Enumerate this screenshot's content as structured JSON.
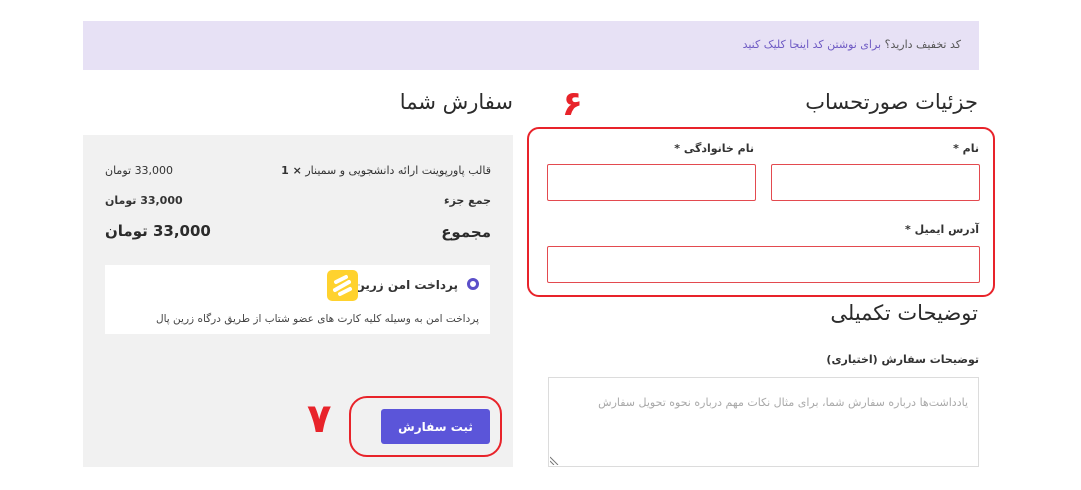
{
  "coupon": {
    "question": "کد تخفیف دارید؟",
    "link": "برای نوشتن کد اینجا کلیک کنید"
  },
  "billing": {
    "title": "جزئیات صورتحساب",
    "first_name_label": "نام",
    "last_name_label": "نام خانوادگی",
    "email_label": "آدرس ایمیل",
    "required_mark": "*"
  },
  "additional": {
    "title": "توضیحات تکمیلی",
    "notes_label": "توضیحات سفارش (اختیاری)",
    "notes_placeholder": "یادداشت‌ها درباره سفارش شما، برای مثال نکات مهم درباره نحوه تحویل سفارش"
  },
  "order": {
    "title": "سفارش شما",
    "product_name": "قالب پاورپوینت ارائه دانشجویی و سمینار",
    "product_qty": "× 1",
    "product_price": "33,000 تومان",
    "subtotal_label": "جمع جزء",
    "subtotal_value": "33,000 تومان",
    "total_label": "مجموع",
    "total_value": "33,000 تومان"
  },
  "payment": {
    "method_label": "پرداخت امن زرین پال",
    "description": "پرداخت امن به وسیله کلیه کارت های عضو شتاب از طریق درگاه زرین پال",
    "selected": true
  },
  "submit_label": "ثبت سفارش",
  "annotations": {
    "step_billing": "۶",
    "step_submit": "۷"
  },
  "colors": {
    "accent": "#5b55d9",
    "annotation": "#e8232a",
    "coupon_bg": "#e7e1f5",
    "panel_bg": "#f1f1f1",
    "logo_bg": "#ffd22e"
  }
}
